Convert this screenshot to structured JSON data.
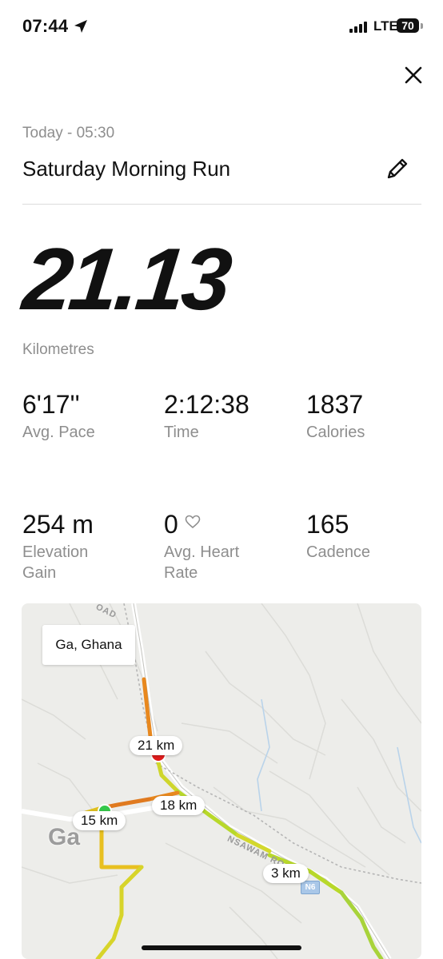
{
  "status_bar": {
    "time": "07:44",
    "network": "LTE",
    "battery": "70"
  },
  "activity": {
    "date": "Today - 05:30",
    "title": "Saturday Morning Run",
    "distance": "21.13",
    "distance_unit": "Kilometres"
  },
  "stats": [
    {
      "value": "6'17''",
      "label": "Avg. Pace"
    },
    {
      "value": "2:12:38",
      "label": "Time"
    },
    {
      "value": "1837",
      "label": "Calories"
    },
    {
      "value": "254 m",
      "label": "Elevation Gain"
    },
    {
      "value": "0",
      "label": "Avg. Heart Rate"
    },
    {
      "value": "165",
      "label": "Cadence"
    }
  ],
  "map": {
    "location_tag": "Ga, Ghana",
    "place_label": "Ga",
    "road_label": "NSAWAM RO",
    "road_label_top": "OAD",
    "route_badge": "N6",
    "km_markers": [
      "21 km",
      "18 km",
      "15 km",
      "3 km"
    ]
  },
  "icons": {
    "location": "location-arrow-icon",
    "close": "close-icon",
    "edit": "pencil-icon",
    "heart": "heart-icon"
  },
  "colors": {
    "start": "#35c84a",
    "end": "#e11d1d",
    "route_fast": "#b8d82a",
    "route_slow": "#e8881e"
  }
}
